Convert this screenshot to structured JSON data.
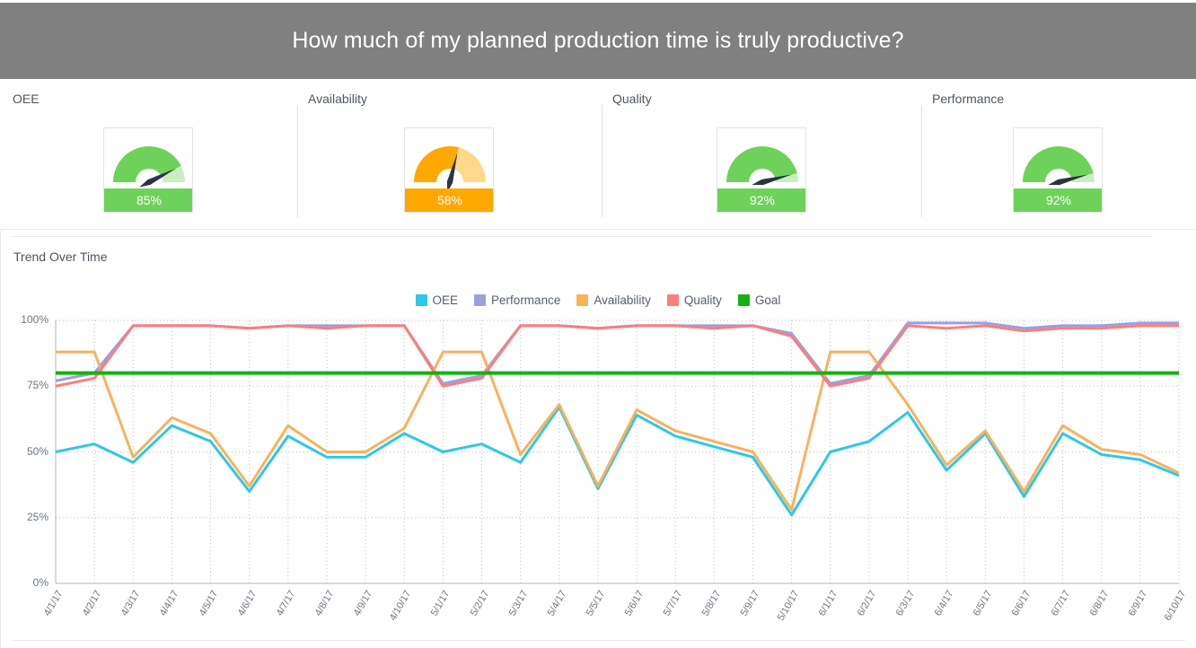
{
  "header": {
    "title": "How much of my planned production time is truly productive?"
  },
  "kpis": [
    {
      "label": "OEE",
      "value": 85,
      "value_text": "85%",
      "color": "#6ed25a",
      "light_color": "#c9efbf",
      "status": "good"
    },
    {
      "label": "Availability",
      "value": 58,
      "value_text": "58%",
      "color": "#ffa800",
      "light_color": "#ffd88a",
      "status": "warning"
    },
    {
      "label": "Quality",
      "value": 92,
      "value_text": "92%",
      "color": "#6ed25a",
      "light_color": "#c9efbf",
      "status": "good"
    },
    {
      "label": "Performance",
      "value": 92,
      "value_text": "92%",
      "color": "#6ed25a",
      "light_color": "#c9efbf",
      "status": "good"
    }
  ],
  "trend": {
    "title": "Trend Over Time"
  },
  "chart_data": {
    "type": "line",
    "title": "Trend Over Time",
    "xlabel": "",
    "ylabel": "",
    "ylim": [
      0,
      100
    ],
    "yticks": [
      0,
      25,
      50,
      75,
      100
    ],
    "ytick_labels": [
      "0%",
      "25%",
      "50%",
      "75%",
      "100%"
    ],
    "grid": true,
    "legend_position": "top-center",
    "categories": [
      "4/1/17",
      "4/2/17",
      "4/3/17",
      "4/4/17",
      "4/5/17",
      "4/6/17",
      "4/7/17",
      "4/8/17",
      "4/9/17",
      "4/10/17",
      "5/1/17",
      "5/2/17",
      "5/3/17",
      "5/4/17",
      "5/5/17",
      "5/6/17",
      "5/7/17",
      "5/8/17",
      "5/9/17",
      "5/10/17",
      "6/1/17",
      "6/2/17",
      "6/3/17",
      "6/4/17",
      "6/5/17",
      "6/6/17",
      "6/7/17",
      "6/8/17",
      "6/9/17",
      "6/10/17"
    ],
    "series": [
      {
        "name": "OEE",
        "color": "#2ec7e8",
        "values": [
          50,
          53,
          46,
          60,
          54,
          35,
          56,
          48,
          48,
          57,
          50,
          53,
          46,
          67,
          36,
          64,
          56,
          52,
          48,
          26,
          50,
          54,
          65,
          43,
          57,
          33,
          57,
          49,
          47,
          41
        ]
      },
      {
        "name": "Performance",
        "color": "#9b9fe0",
        "values": [
          77,
          80,
          98,
          98,
          98,
          97,
          98,
          98,
          98,
          98,
          76,
          79,
          98,
          98,
          97,
          98,
          98,
          98,
          98,
          95,
          76,
          79,
          99,
          99,
          99,
          97,
          98,
          98,
          99,
          99
        ]
      },
      {
        "name": "Availability",
        "color": "#f7b25c",
        "values": [
          88,
          88,
          48,
          63,
          57,
          37,
          60,
          50,
          50,
          59,
          88,
          88,
          49,
          68,
          37,
          66,
          58,
          54,
          50,
          28,
          88,
          88,
          68,
          45,
          58,
          35,
          60,
          51,
          49,
          42
        ]
      },
      {
        "name": "Quality",
        "color": "#fc7e7e",
        "values": [
          75,
          78,
          98,
          98,
          98,
          97,
          98,
          97,
          98,
          98,
          75,
          78,
          98,
          98,
          97,
          98,
          98,
          97,
          98,
          94,
          75,
          78,
          98,
          97,
          98,
          96,
          97,
          97,
          98,
          98
        ]
      },
      {
        "name": "Goal",
        "color": "#12b312",
        "values": [
          80,
          80,
          80,
          80,
          80,
          80,
          80,
          80,
          80,
          80,
          80,
          80,
          80,
          80,
          80,
          80,
          80,
          80,
          80,
          80,
          80,
          80,
          80,
          80,
          80,
          80,
          80,
          80,
          80,
          80
        ]
      }
    ]
  }
}
